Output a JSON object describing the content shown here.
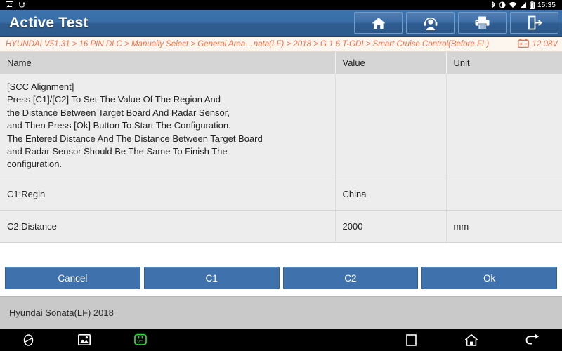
{
  "statusbar": {
    "icons_left": [
      "screenshot-icon",
      "usb-icon"
    ],
    "icons_right": [
      "bluetooth-icon",
      "brightness-icon",
      "wifi-icon",
      "signal-icon",
      "battery-icon"
    ],
    "time": "15:35"
  },
  "titlebar": {
    "title": "Active Test",
    "buttons": [
      {
        "name": "home-button",
        "icon": "home-icon"
      },
      {
        "name": "support-button",
        "icon": "headset-icon"
      },
      {
        "name": "print-button",
        "icon": "printer-icon"
      },
      {
        "name": "exit-button",
        "icon": "exit-icon"
      }
    ],
    "accent_color": "#2f5d91"
  },
  "breadcrumb": {
    "path": "HYUNDAI V51.31 > 16 PIN DLC > Manually Select > General Area…nata(LF) > 2018 > G 1.6 T-GDI > Smart Cruise Control(Before FL)",
    "battery_icon": "car-battery-icon",
    "voltage": "12.08V",
    "text_color": "#f4704a"
  },
  "table": {
    "headers": {
      "name": "Name",
      "value": "Value",
      "unit": "Unit"
    },
    "instruction_row": {
      "lines": [
        "[SCC Alignment]",
        "Press [C1]/[C2] To Set The Value Of The Region And",
        "the Distance Between Target Board And Radar Sensor,",
        "and Then Press [Ok] Button To Start The Configuration.",
        "The Entered Distance And The Distance Between Target Board",
        "and Radar Sensor Should Be The Same To Finish The",
        "configuration."
      ],
      "value": "",
      "unit": ""
    },
    "rows": [
      {
        "name": "C1:Regin",
        "value": "China",
        "unit": ""
      },
      {
        "name": "C2:Distance",
        "value": "2000",
        "unit": "mm"
      }
    ]
  },
  "actions": [
    {
      "name": "cancel-button",
      "label": "Cancel"
    },
    {
      "name": "c1-button",
      "label": "C1"
    },
    {
      "name": "c2-button",
      "label": "C2"
    },
    {
      "name": "ok-button",
      "label": "Ok"
    }
  ],
  "footer": {
    "vehicle": "Hyundai Sonata(LF) 2018"
  },
  "navbar": {
    "icons": [
      "browser-icon",
      "gallery-icon",
      "vci-icon",
      "recents-icon",
      "home-icon",
      "back-icon"
    ],
    "vci_color": "#2ecc40"
  }
}
